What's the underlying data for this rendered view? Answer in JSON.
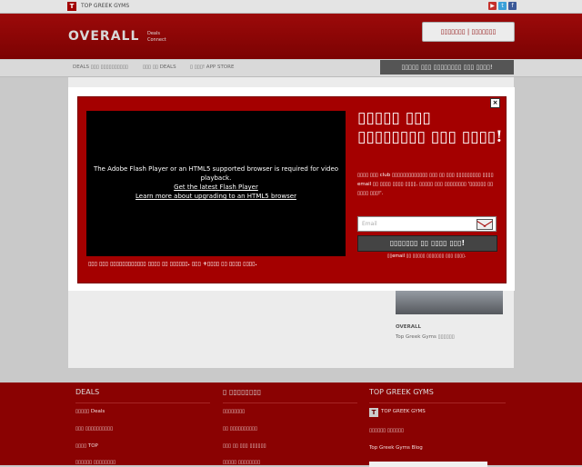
{
  "topbar": {
    "site_name": "TOP GREEK GYMS",
    "t_badge": "T",
    "social_icons": [
      "youtube-icon",
      "twitter-icon",
      "facebook-icon"
    ]
  },
  "header": {
    "logo": "OVERALL",
    "logo_sub1": "Deals",
    "logo_sub2": "Connect",
    "login_label": "▯▯▯▯▯▯▯ | ▯▯▯▯▯▯▯"
  },
  "nav": {
    "items": [
      "DEALS ▯▯▯ ▯▯▯▯▯▯▯▯▯▯",
      "▯▯▯ ▯▯ DEALS",
      "▯ ▯▯▯! APP STORE"
    ],
    "cta": "▯▯▯▯▯ ▯▯▯ ▯▯▯▯▯▯▯▯ ▯▯▯ ▯▯▯▯!"
  },
  "sidebar": {
    "card_title": "OVERALL",
    "card_sub": "Top Greek Gyms ▯▯▯▯▯▯"
  },
  "popup": {
    "close_label": "×",
    "video_msg": "The Adobe Flash Player or an HTML5 supported browser is required for video playback.",
    "video_link1": "Get the latest Flash Player",
    "video_link2": "Learn more about upgrading to an HTML5 browser",
    "title": "▯▯▯▯▯ ▯▯▯ ▯▯▯▯▯▯▯▯ ▯▯▯ ▯▯▯▯!",
    "description": "▯▯▯▯ ▯▯▯ club ▯▯▯▯▯▯▯▯▯▯▯▯▯ ▯▯▯ ▯▯ ▯▯▯ ▯▯▯▯▯▯▯▯▯ ▯▯▯▯ email ▯▯ ▯▯▯▯ ▯▯▯▯ ▯▯▯▯, ▯▯▯▯▯ ▯▯▯ ▯▯▯▯▯▯▯▯ '▯▯▯▯▯▯ ▯▯ ▯▯▯▯ ▯▯▯!'.",
    "email_placeholder": "Email",
    "submit_label": "▯▯▯▯▯▯▯ ▯▯ ▯▯▯▯ ▯▯▯!",
    "submit_note": "▯▯email ▯▯ ▯▯▯▯▯ ▯▯▯▯▯▯▯ ▯▯▯ ▯▯▯▯.",
    "bottom_note": "▯▯▯ ▯▯▯ ▯▯▯▯▯▯▯▯▯▯▯▯ ▯▯▯▯ ▯▯ ▯▯▯▯▯▯. ▯▯▯ +▯▯▯▯ ▯▯ ▯▯▯▯ ▯▯▯▯."
  },
  "footer": {
    "col1": {
      "title": "DEALS",
      "links": [
        "▯▯▯▯▯ Deals",
        "▯▯▯ ▯▯▯▯▯▯▯▯▯▯",
        "▯▯▯▯ TOP",
        "▯▯▯▯▯▯ ▯▯▯▯▯▯▯▯"
      ]
    },
    "col2": {
      "title": "▯ ▯▯▯▯▯▯▯▯",
      "links": [
        "▯▯▯▯▯▯▯▯",
        "▯▯ ▯▯▯▯▯▯▯▯▯▯",
        "▯▯▯ ▯▯ ▯▯▯ ▯▯▯▯▯▯",
        "▯▯▯▯▯ ▯▯▯▯▯▯▯▯"
      ]
    },
    "col3": {
      "title": "TOP GREEK GYMS",
      "links": [
        "TOP GREEK GYMS",
        "▯▯▯▯▯▯ ▯▯▯▯▯▯",
        "Top Greek Gyms Blog"
      ]
    }
  },
  "colors": {
    "brand_red": "#a40000",
    "dark_red": "#8a0202"
  }
}
